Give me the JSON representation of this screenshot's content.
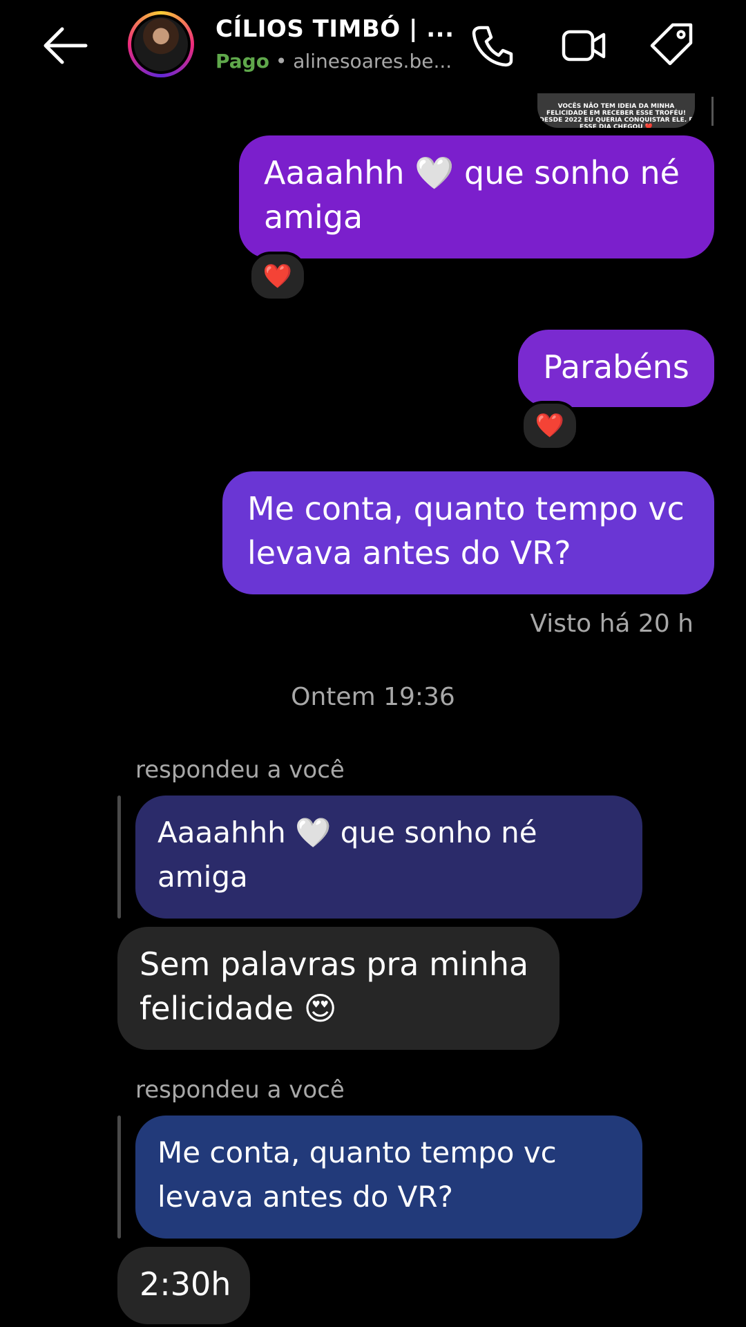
{
  "header": {
    "title": "CÍLIOS TIMBÓ | ...",
    "paid_label": "Pago",
    "separator": " • ",
    "handle": "alinesoares.be..."
  },
  "icons": {
    "back": "back-arrow-icon",
    "call": "phone-icon",
    "video": "video-camera-icon",
    "tag": "tag-icon"
  },
  "shared_media": {
    "caption": "VOCÊS NÃO TEM IDEIA DA MINHA FELICIDADE EM RECEBER ESSE TROFÉU! DESDE 2022 EU QUERIA CONQUISTAR ELE. E ESSE DIA CHEGOU ❤️"
  },
  "messages": {
    "sent1": "Aaaahhh 🤍 que sonho né amiga",
    "sent1_reaction": "❤️",
    "sent2": "Parabéns",
    "sent2_reaction": "❤️",
    "sent3": "Me conta, quanto tempo vc levava antes do VR?",
    "seen": "Visto há 20 h",
    "day_stamp": "Ontem 19:36",
    "reply_label_1": "respondeu a você",
    "quoted_1": "Aaaahhh 🤍 que sonho né amiga",
    "received_1": "Sem palavras pra minha felicidade 😍",
    "reply_label_2": "respondeu a você",
    "quoted_2": "Me conta, quanto tempo vc levava antes do VR?",
    "received_2": "2:30h"
  },
  "colors": {
    "sent_bubble_1": "#7b1fcc",
    "sent_bubble_2": "#7a2ad0",
    "sent_bubble_3": "#6a36d4",
    "received_bubble": "#262626",
    "quoted_1": "#2b2b6a",
    "quoted_2": "#223a7a",
    "paid_green": "#5fa84b"
  }
}
